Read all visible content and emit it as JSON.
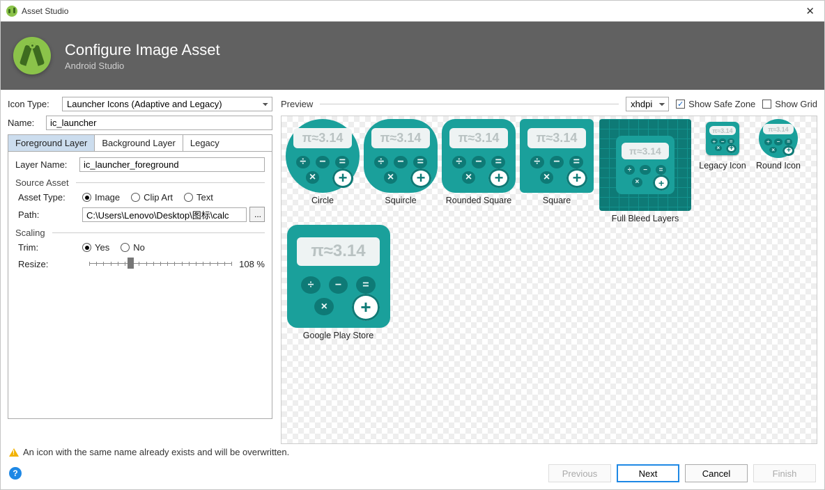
{
  "titlebar": {
    "title": "Asset Studio"
  },
  "banner": {
    "title": "Configure Image Asset",
    "subtitle": "Android Studio"
  },
  "left": {
    "icon_type_label": "Icon Type:",
    "icon_type_value": "Launcher Icons (Adaptive and Legacy)",
    "name_label": "Name:",
    "name_value": "ic_launcher",
    "tabs": {
      "fg": "Foreground Layer",
      "bg": "Background Layer",
      "legacy": "Legacy"
    },
    "layer_name_label": "Layer Name:",
    "layer_name_value": "ic_launcher_foreground",
    "source_asset": "Source Asset",
    "asset_type_label": "Asset Type:",
    "asset_type": {
      "image": "Image",
      "clipart": "Clip Art",
      "text": "Text"
    },
    "path_label": "Path:",
    "path_value": "C:\\Users\\Lenovo\\Desktop\\图标\\calc",
    "browse_label": "...",
    "scaling": "Scaling",
    "trim_label": "Trim:",
    "trim": {
      "yes": "Yes",
      "no": "No"
    },
    "resize_label": "Resize:",
    "resize_value": "108 %"
  },
  "preview": {
    "label": "Preview",
    "density": "xhdpi",
    "show_safe_zone": "Show Safe Zone",
    "show_grid": "Show Grid",
    "calc_text": "π≈3.14",
    "labels": {
      "circle": "Circle",
      "squircle": "Squircle",
      "rounded": "Rounded Square",
      "square": "Square",
      "fullbleed": "Full Bleed Layers",
      "legacy": "Legacy Icon",
      "round": "Round Icon",
      "gplay": "Google Play Store"
    }
  },
  "warning": "An icon with the same name already exists and will be overwritten.",
  "footer": {
    "previous": "Previous",
    "next": "Next",
    "cancel": "Cancel",
    "finish": "Finish"
  }
}
